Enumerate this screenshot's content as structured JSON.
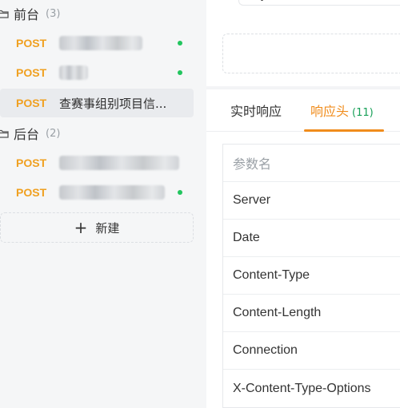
{
  "sidebar": {
    "groups": [
      {
        "title": "前台",
        "count": "(3)"
      },
      {
        "title": "后台",
        "count": "(2)"
      }
    ],
    "items": [
      {
        "method": "POST",
        "name": "",
        "redacted": true,
        "status": "green"
      },
      {
        "method": "POST",
        "name": "",
        "redacted": true,
        "status": "green"
      },
      {
        "method": "POST",
        "name": "查赛事组别项目信...",
        "redacted": false,
        "selected": true
      },
      {
        "method": "POST",
        "name": "",
        "redacted": true
      },
      {
        "method": "POST",
        "name": "",
        "redacted": true,
        "status": "green"
      }
    ],
    "new_button": {
      "icon": "plus-icon",
      "label": "新建"
    }
  },
  "response_panel": {
    "code_fragment": "}",
    "tabs": [
      {
        "label": "实时响应",
        "active": false
      },
      {
        "label": "响应头",
        "count": "(11)",
        "active": true
      }
    ],
    "headers_table": {
      "column_header": "参数名",
      "rows": [
        "Server",
        "Date",
        "Content-Type",
        "Content-Length",
        "Connection",
        "X-Content-Type-Options"
      ]
    }
  },
  "colors": {
    "method_post": "#f0a020",
    "active_tab": "#f08c1c",
    "count_green": "#18a058",
    "status_dot": "#22c55e"
  }
}
